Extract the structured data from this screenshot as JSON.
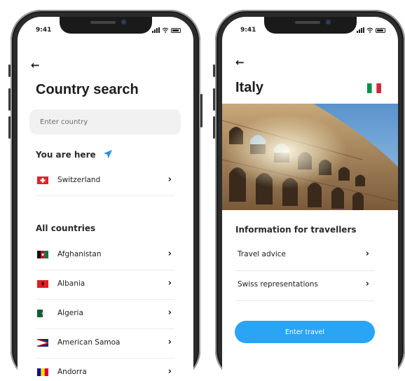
{
  "status": {
    "time": "9:41"
  },
  "search_screen": {
    "back_icon": "arrow-left-icon",
    "title": "Country search",
    "search_placeholder": "Enter country",
    "you_are_here_label": "You are here",
    "you_are_here_icon": "location-arrow-icon",
    "current_location": {
      "name": "Switzerland",
      "flag": "flag-switzerland"
    },
    "all_countries_label": "All countries",
    "countries": [
      {
        "name": "Afghanistan",
        "flag": "flag-afghanistan"
      },
      {
        "name": "Albania",
        "flag": "flag-albania"
      },
      {
        "name": "Algeria",
        "flag": "flag-algeria"
      },
      {
        "name": "American Samoa",
        "flag": "flag-american-samoa"
      },
      {
        "name": "Andorra",
        "flag": "flag-andorra"
      }
    ],
    "row_icon": "chevron-right-icon"
  },
  "country_screen": {
    "back_icon": "arrow-left-icon",
    "title": "Italy",
    "flag": "flag-italy",
    "photo": "colosseum-photo",
    "info_heading": "Information for travellers",
    "items": [
      {
        "label": "Travel advice"
      },
      {
        "label": "Swiss representations"
      }
    ],
    "cta_label": "Enter travel"
  },
  "colors": {
    "accent": "#2aa5f5",
    "location_icon": "#2b8de0"
  }
}
